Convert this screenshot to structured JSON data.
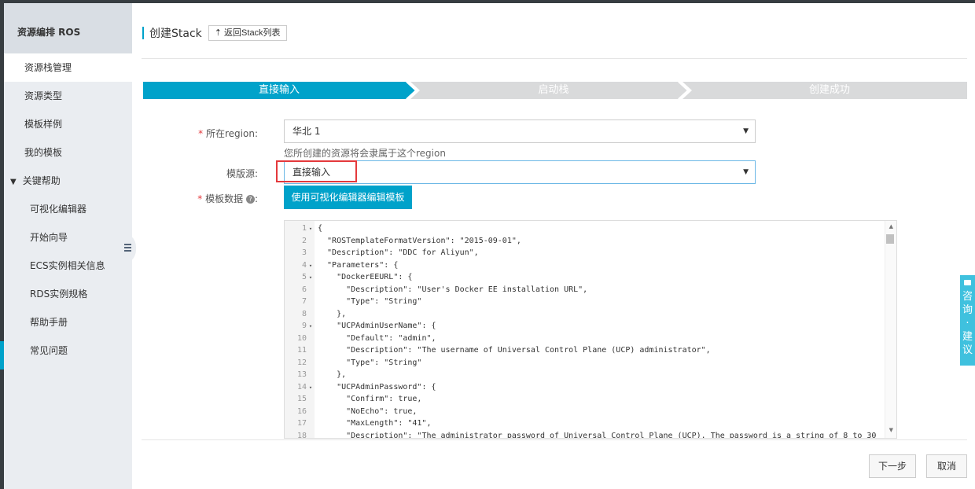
{
  "sidebar": {
    "title": "资源编排 ROS",
    "items": [
      {
        "label": "资源栈管理"
      },
      {
        "label": "资源类型"
      },
      {
        "label": "模板样例"
      },
      {
        "label": "我的模板"
      }
    ],
    "group": {
      "label": "关键帮助"
    },
    "subitems": [
      {
        "label": "可视化编辑器"
      },
      {
        "label": "开始向导"
      },
      {
        "label": "ECS实例相关信息"
      },
      {
        "label": "RDS实例规格"
      },
      {
        "label": "帮助手册"
      },
      {
        "label": "常见问题"
      }
    ]
  },
  "header": {
    "title": "创建Stack",
    "back_label": "返回Stack列表",
    "back_icon": "upload-icon"
  },
  "steps": [
    {
      "label": "直接输入",
      "state": "active"
    },
    {
      "label": "启动栈",
      "state": "inactive"
    },
    {
      "label": "创建成功",
      "state": "inactive"
    }
  ],
  "form": {
    "region_label": "所在region:",
    "region_value": "华北 1",
    "region_hint": "您所创建的资源将会隶属于这个region",
    "source_label": "模版源:",
    "source_value": "直接输入",
    "data_label": "模板数据",
    "data_colon": ":",
    "visual_editor_btn": "使用可视化编辑器编辑模板",
    "required_mark": "*"
  },
  "editor": {
    "lines": [
      {
        "n": "1",
        "fold": "▾",
        "text": "{"
      },
      {
        "n": "2",
        "fold": "",
        "text": "  \"ROSTemplateFormatVersion\": \"2015-09-01\","
      },
      {
        "n": "3",
        "fold": "",
        "text": "  \"Description\": \"DDC for Aliyun\","
      },
      {
        "n": "4",
        "fold": "▾",
        "text": "  \"Parameters\": {"
      },
      {
        "n": "5",
        "fold": "▾",
        "text": "    \"DockerEEURL\": {"
      },
      {
        "n": "6",
        "fold": "",
        "text": "      \"Description\": \"User's Docker EE installation URL\","
      },
      {
        "n": "7",
        "fold": "",
        "text": "      \"Type\": \"String\""
      },
      {
        "n": "8",
        "fold": "",
        "text": "    },"
      },
      {
        "n": "9",
        "fold": "▾",
        "text": "    \"UCPAdminUserName\": {"
      },
      {
        "n": "10",
        "fold": "",
        "text": "      \"Default\": \"admin\","
      },
      {
        "n": "11",
        "fold": "",
        "text": "      \"Description\": \"The username of Universal Control Plane (UCP) administrator\","
      },
      {
        "n": "12",
        "fold": "",
        "text": "      \"Type\": \"String\""
      },
      {
        "n": "13",
        "fold": "",
        "text": "    },"
      },
      {
        "n": "14",
        "fold": "▾",
        "text": "    \"UCPAdminPassword\": {"
      },
      {
        "n": "15",
        "fold": "",
        "text": "      \"Confirm\": true,"
      },
      {
        "n": "16",
        "fold": "",
        "text": "      \"NoEcho\": true,"
      },
      {
        "n": "17",
        "fold": "",
        "text": "      \"MaxLength\": \"41\","
      },
      {
        "n": "18",
        "fold": "",
        "text": "      \"Description\": \"The administrator password of Universal Control Plane (UCP). The password is a string of 8 to 30"
      }
    ]
  },
  "footer": {
    "next_label": "下一步",
    "cancel_label": "取消"
  },
  "consult": {
    "label": "咨询·建议"
  },
  "colors": {
    "accent": "#00a2ca",
    "required": "#e4393c",
    "sidebar_bg": "#eaedf1",
    "step_inactive": "#d9dadb"
  }
}
